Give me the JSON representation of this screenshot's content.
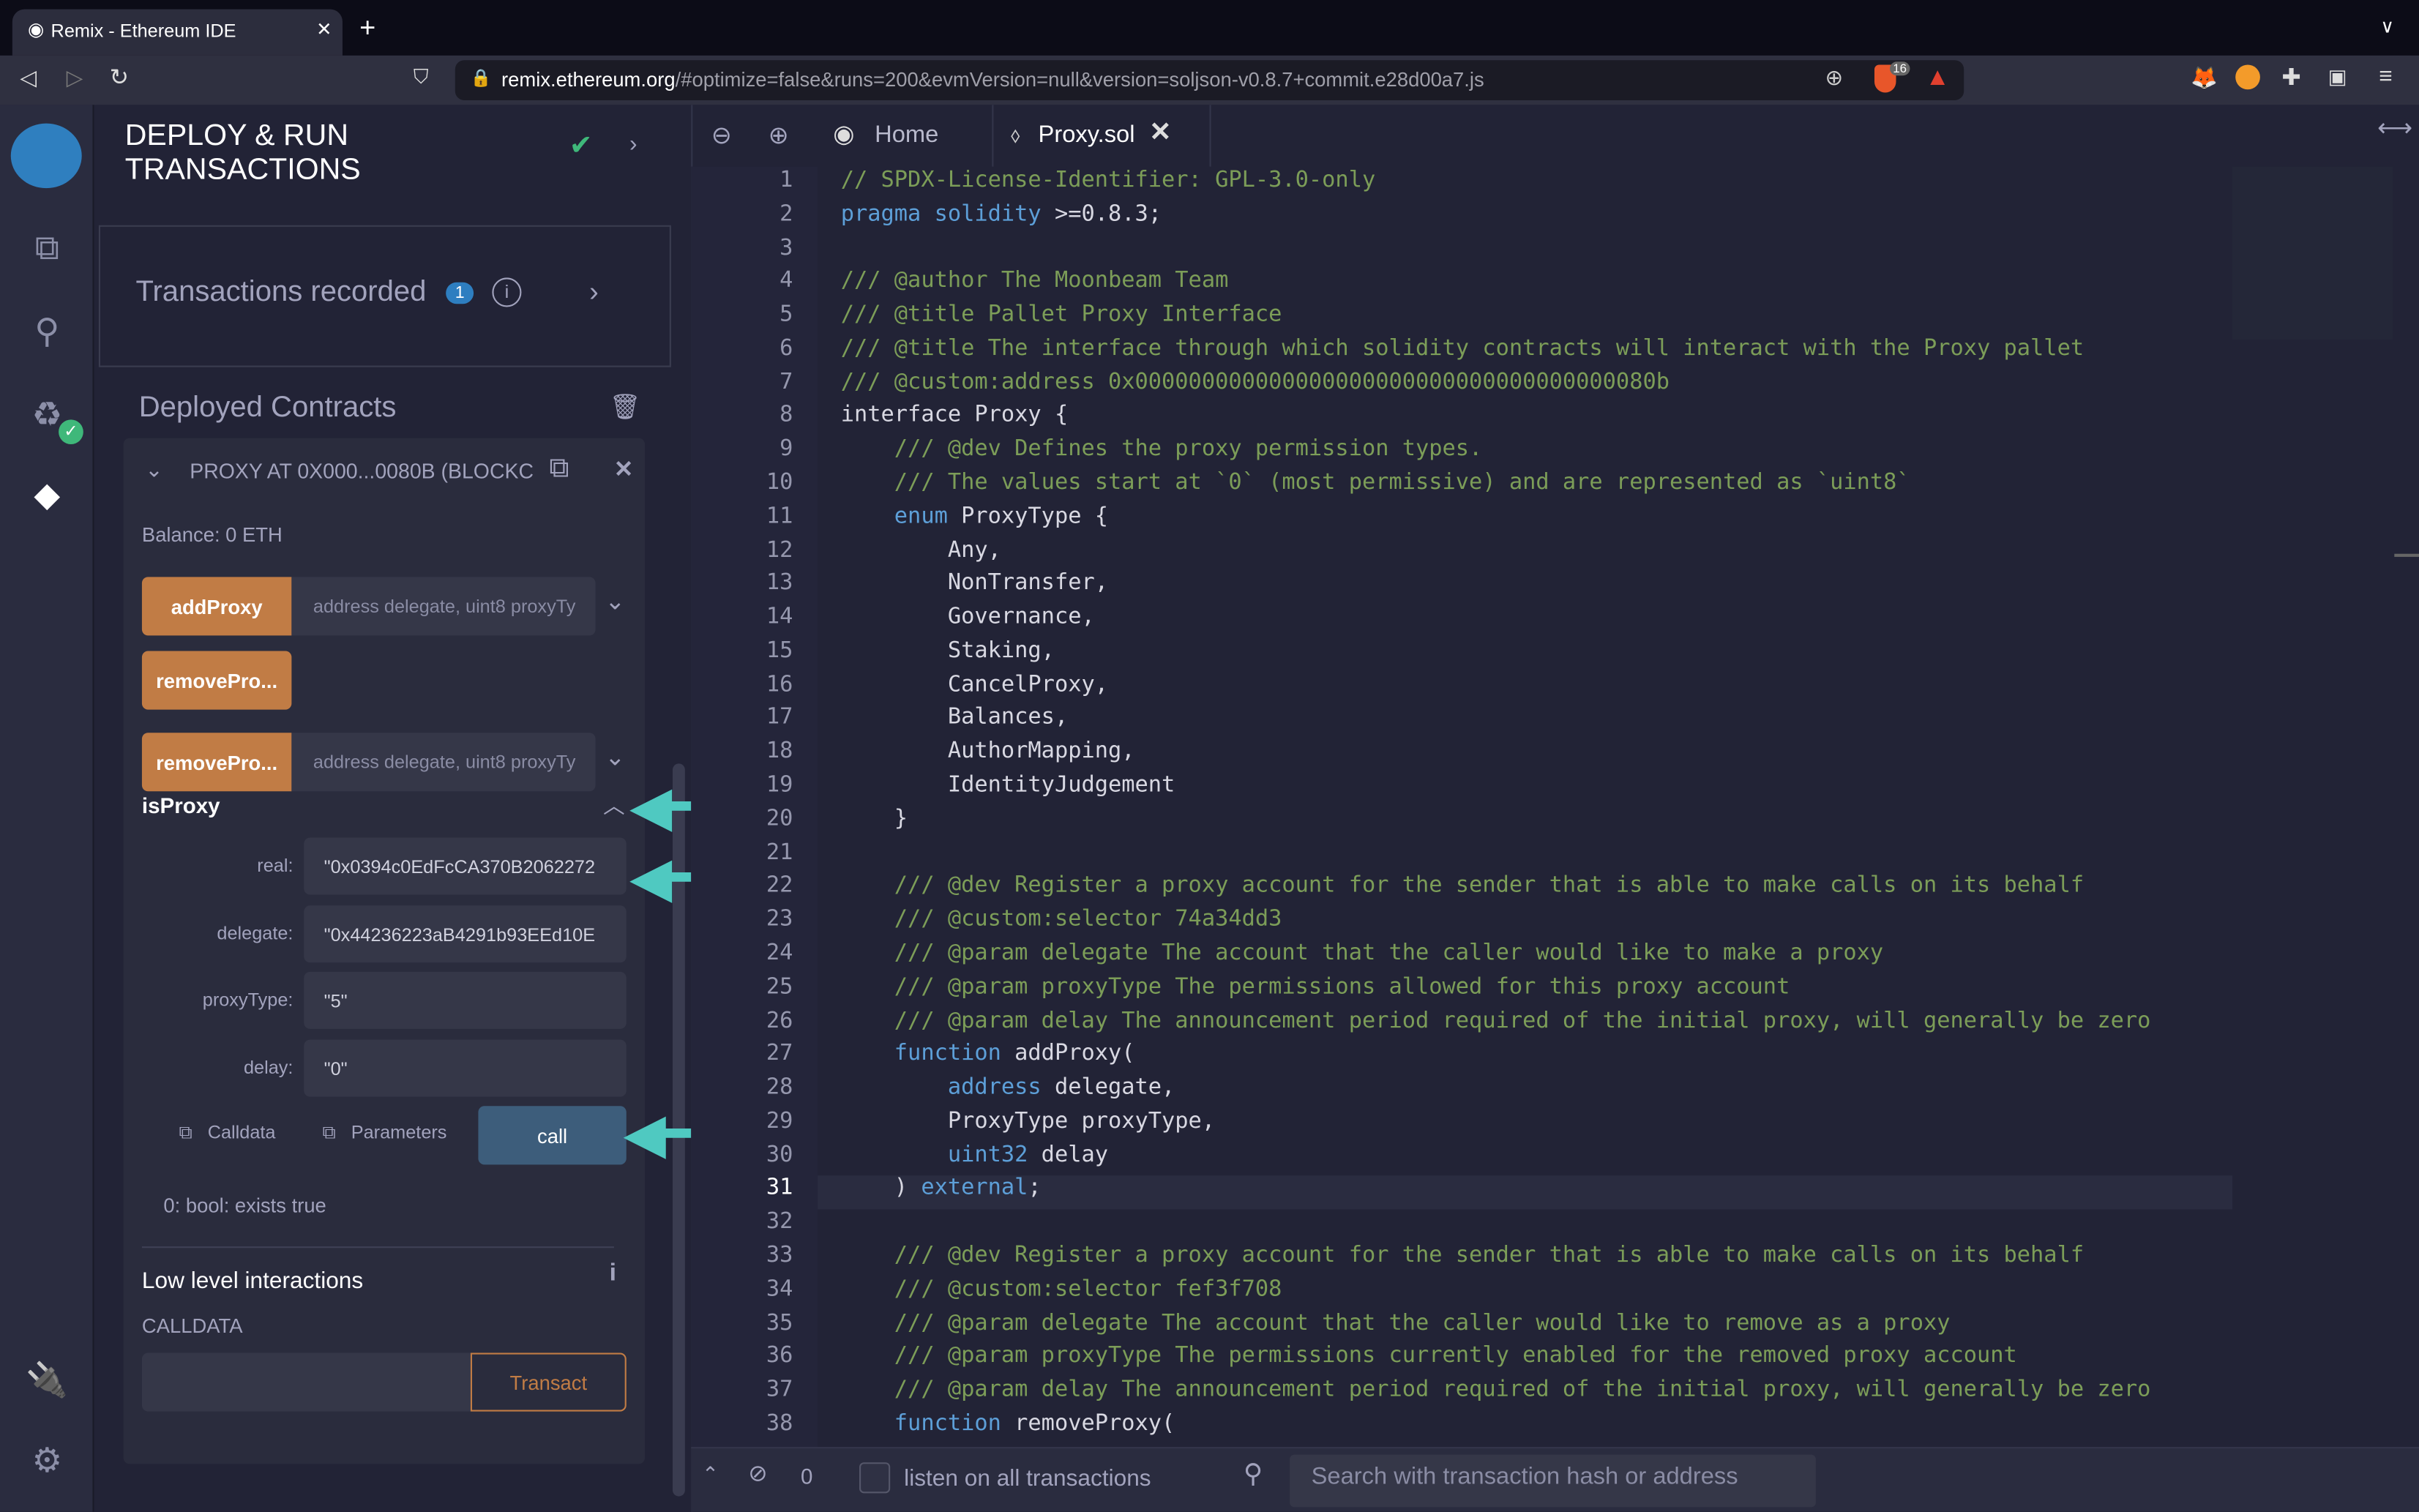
{
  "browser": {
    "tab_title": "Remix - Ethereum IDE",
    "url_domain": "remix.ethereum.org",
    "url_rest": "/#optimize=false&runs=200&evmVersion=null&version=soljson-v0.8.7+commit.e28d00a7.js",
    "brave_badge": "16"
  },
  "side": {
    "title_line1": "DEPLOY & RUN",
    "title_line2": "TRANSACTIONS",
    "tx_recorded": "Transactions recorded",
    "tx_count": "1",
    "deployed_title": "Deployed Contracts",
    "contract": {
      "name": "PROXY AT 0X000...0080B (BLOCKC",
      "balance": "Balance: 0 ETH",
      "functions": [
        {
          "label": "addProxy",
          "placeholder": "address delegate, uint8 proxyTy"
        },
        {
          "label": "removePro..."
        },
        {
          "label": "removePro...",
          "placeholder": "address delegate, uint8 proxyTy"
        }
      ],
      "isProxy": {
        "label": "isProxy",
        "fields": [
          {
            "label": "real:",
            "value": "\"0x0394c0EdFcCA370B2062272"
          },
          {
            "label": "delegate:",
            "value": "\"0x44236223aB4291b93EEd10E"
          },
          {
            "label": "proxyType:",
            "value": "\"5\""
          },
          {
            "label": "delay:",
            "value": "\"0\""
          }
        ],
        "calldata": "Calldata",
        "parameters": "Parameters",
        "call": "call",
        "result": "0: bool: exists true"
      }
    },
    "low_level": {
      "title": "Low level interactions",
      "calldata_label": "CALLDATA",
      "transact": "Transact"
    }
  },
  "annotations": [
    "1",
    "2",
    "3"
  ],
  "editor": {
    "tabs": [
      {
        "label": "Home"
      },
      {
        "label": "Proxy.sol"
      }
    ],
    "current_line": 31,
    "lines": [
      [
        [
          "c",
          "// SPDX-License-Identifier: GPL-3.0-only"
        ]
      ],
      [
        [
          "k",
          "pragma solidity"
        ],
        [
          "t",
          " >=0.8.3;"
        ]
      ],
      [],
      [
        [
          "c",
          "/// @author The Moonbeam Team"
        ]
      ],
      [
        [
          "c",
          "/// @title Pallet Proxy Interface"
        ]
      ],
      [
        [
          "c",
          "/// @title The interface through which solidity contracts will interact with the Proxy pallet"
        ]
      ],
      [
        [
          "c",
          "/// @custom:address 0x000000000000000000000000000000000000080b"
        ]
      ],
      [
        [
          "t",
          "interface Proxy {"
        ]
      ],
      [
        [
          "c",
          "    /// @dev Defines the proxy permission types."
        ]
      ],
      [
        [
          "c",
          "    /// The values start at `0` (most permissive) and are represented as `uint8`"
        ]
      ],
      [
        [
          "k",
          "    enum"
        ],
        [
          "t",
          " ProxyType {"
        ]
      ],
      [
        [
          "t",
          "        Any,"
        ]
      ],
      [
        [
          "t",
          "        NonTransfer,"
        ]
      ],
      [
        [
          "t",
          "        Governance,"
        ]
      ],
      [
        [
          "t",
          "        Staking,"
        ]
      ],
      [
        [
          "t",
          "        CancelProxy,"
        ]
      ],
      [
        [
          "t",
          "        Balances,"
        ]
      ],
      [
        [
          "t",
          "        AuthorMapping,"
        ]
      ],
      [
        [
          "t",
          "        IdentityJudgement"
        ]
      ],
      [
        [
          "t",
          "    }"
        ]
      ],
      [],
      [
        [
          "c",
          "    /// @dev Register a proxy account for the sender that is able to make calls on its behalf"
        ]
      ],
      [
        [
          "c",
          "    /// @custom:selector 74a34dd3"
        ]
      ],
      [
        [
          "c",
          "    /// @param delegate The account that the caller would like to make a proxy"
        ]
      ],
      [
        [
          "c",
          "    /// @param proxyType The permissions allowed for this proxy account"
        ]
      ],
      [
        [
          "c",
          "    /// @param delay The announcement period required of the initial proxy, will generally be zero"
        ]
      ],
      [
        [
          "k",
          "    function"
        ],
        [
          "t",
          " addProxy("
        ]
      ],
      [
        [
          "k",
          "        address"
        ],
        [
          "t",
          " delegate,"
        ]
      ],
      [
        [
          "t",
          "        ProxyType proxyType,"
        ]
      ],
      [
        [
          "k",
          "        uint32"
        ],
        [
          "t",
          " delay"
        ]
      ],
      [
        [
          "t",
          "    ) "
        ],
        [
          "k",
          "external"
        ],
        [
          "t",
          ";"
        ]
      ],
      [],
      [
        [
          "c",
          "    /// @dev Register a proxy account for the sender that is able to make calls on its behalf"
        ]
      ],
      [
        [
          "c",
          "    /// @custom:selector fef3f708"
        ]
      ],
      [
        [
          "c",
          "    /// @param delegate The account that the caller would like to remove as a proxy"
        ]
      ],
      [
        [
          "c",
          "    /// @param proxyType The permissions currently enabled for the removed proxy account"
        ]
      ],
      [
        [
          "c",
          "    /// @param delay The announcement period required of the initial proxy, will generally be zero"
        ]
      ],
      [
        [
          "k",
          "    function"
        ],
        [
          "t",
          " removeProxy("
        ]
      ]
    ]
  },
  "terminal": {
    "count": "0",
    "listen_label": "listen on all transactions",
    "search_placeholder": "Search with transaction hash or address"
  },
  "colors": {
    "accent_orange": "#c17c45",
    "call_blue": "#3d5d7b",
    "annotation_teal": "#4fc9c1",
    "comment": "#7c9d58",
    "keyword": "#5d9fd8"
  }
}
